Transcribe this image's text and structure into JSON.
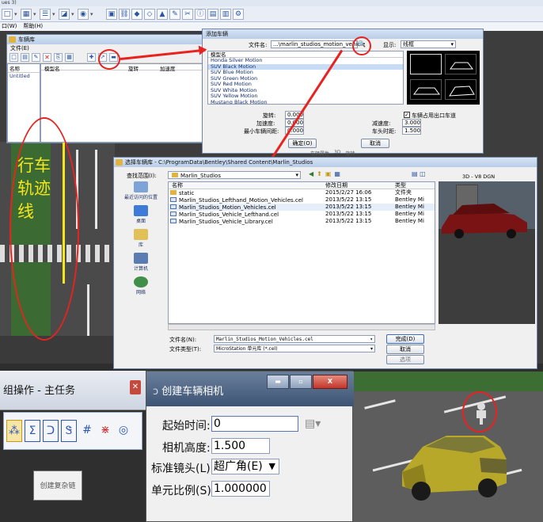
{
  "app": {
    "title_fragment": "ues 3)",
    "menu": [
      "口(W)",
      "帮助(H)"
    ]
  },
  "toolbar_icons": [
    "new-icon",
    "dropdown",
    "grid-icon",
    "dropdown",
    "list-icon",
    "dropdown",
    "view-icon",
    "dropdown",
    "camera-icon",
    "dropdown",
    "select-icon",
    "link-icon",
    "shape-icon",
    "shape-icon",
    "shape-icon",
    "paint-icon",
    "tool-icon",
    "info-icon",
    "image-icon",
    "chart-icon",
    "settings-icon"
  ],
  "vehicle_library": {
    "title": "车辆库",
    "menu_file": "文件(E)",
    "col_name": "名称",
    "col_model": "模型名",
    "col_rotation": "旋转",
    "col_accel": "加速度",
    "tree_item": "Untitled"
  },
  "add_vehicle": {
    "title": "添加车辆",
    "file_label": "文件名:",
    "file_value": "...\\marlin_studios_motion_vehicle",
    "display_label": "显示:",
    "display_value": "线框",
    "list_header": "模型名",
    "models": [
      "Honda Silver Motion",
      "SUV Black Motion",
      "SUV Blue Motion",
      "SUV Green Motion",
      "SUV Red Motion",
      "SUV White Motion",
      "SUV Yellow Motion",
      "Mustang Black Motion",
      "Mustang Blue Motion"
    ],
    "selected_index": 1,
    "rotation_label": "旋转:",
    "rotation_value": "0.000",
    "accel_label": "加速度:",
    "accel_value": "0.000",
    "min_gap_label": "最小车辆间距:",
    "min_gap_value": "0.000",
    "decel_label": "减速度:",
    "decel_value": "3.000",
    "headtime_label": "车头时距:",
    "headtime_value": "1.500",
    "checkbox_label": "车辆占用出口车道",
    "ok": "确定(O)",
    "cancel": "取消",
    "partial_tabs": [
      "车辆属性",
      "3D",
      "旋转"
    ]
  },
  "annotation": {
    "vertical_text": [
      "行车",
      "轨迹",
      "线"
    ]
  },
  "file_dialog": {
    "title": "选择车辆库",
    "path": "C:\\ProgramData\\Bentley\\Shared Content\\Marlin_Studios",
    "lookin_label": "查找范围(I):",
    "lookin_value": "Marlin_Studios",
    "col_name": "名称",
    "col_date": "修改日期",
    "col_type": "类型",
    "preview_label": "3D - V8 DGN",
    "nav": [
      "最近访问的位置",
      "桌面",
      "库",
      "计算机",
      "网络"
    ],
    "files": [
      {
        "name": "static",
        "date": "2015/2/27 16:06",
        "type": "文件夹",
        "kind": "folder"
      },
      {
        "name": "Marlin_Studios_Lefthand_Motion_Vehicles.cel",
        "date": "2013/5/22 13:15",
        "type": "Bentley Mi",
        "kind": "cel"
      },
      {
        "name": "Marlin_Studios_Motion_Vehicles.cel",
        "date": "2013/5/22 13:15",
        "type": "Bentley Mi",
        "kind": "cel"
      },
      {
        "name": "Marlin_Studios_Vehicle_Lefthand.cel",
        "date": "2013/5/22 13:15",
        "type": "Bentley Mi",
        "kind": "cel"
      },
      {
        "name": "Marlin_Studios_Vehicle_Library.cel",
        "date": "2013/5/22 13:15",
        "type": "Bentley Mi",
        "kind": "cel"
      }
    ],
    "filename_label": "文件名(N):",
    "filename_value": "Marlin_Studios_Motion_Vehicles.cel",
    "filetype_label": "文件类型(T):",
    "filetype_value": "MicroStation 单元库 (*.cel)",
    "btn_done": "完成(D)",
    "btn_cancel": "取消",
    "btn_options": "选项"
  },
  "task_panel": {
    "title": "组操作 - 主任务",
    "tooltip": "创建复杂链"
  },
  "camera_dialog": {
    "title": "创建车辆相机",
    "start_time_label": "起始时间:",
    "start_time_value": "0",
    "camera_height_label": "相机高度:",
    "camera_height_value": "1.500",
    "lens_label": "标准镜头(L):",
    "lens_value": "超广角(E)",
    "scale_label": "单元比例(S):",
    "scale_value": "1.000000"
  }
}
